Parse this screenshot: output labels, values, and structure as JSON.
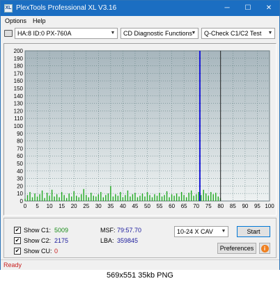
{
  "window": {
    "title": "PlexTools Professional XL V3.16",
    "icon_text": "XL",
    "minimize": "─",
    "maximize": "☐",
    "close": "✕"
  },
  "menu": [
    "Options",
    "Help"
  ],
  "toolbar": {
    "drive": "HA:8 ID:0  PX-760A",
    "function": "CD Diagnostic Functions",
    "test": "Q-Check C1/C2 Test"
  },
  "chart_data": {
    "type": "area",
    "title": "",
    "xlabel": "",
    "ylabel": "",
    "xlim": [
      0,
      100
    ],
    "ylim": [
      0,
      200
    ],
    "x_ticks": [
      0,
      5,
      10,
      15,
      20,
      25,
      30,
      35,
      40,
      45,
      50,
      55,
      60,
      65,
      70,
      75,
      80,
      85,
      90,
      95,
      100
    ],
    "y_ticks": [
      0,
      10,
      20,
      30,
      40,
      50,
      60,
      70,
      80,
      90,
      100,
      110,
      120,
      130,
      140,
      150,
      160,
      170,
      180,
      190,
      200
    ],
    "grid": true,
    "series": [
      {
        "color": "#1fa81f",
        "x": [
          0,
          1,
          2,
          3,
          4,
          5,
          6,
          7,
          8,
          9,
          10,
          11,
          12,
          13,
          14,
          15,
          16,
          17,
          18,
          19,
          20,
          21,
          22,
          23,
          24,
          25,
          26,
          27,
          28,
          29,
          30,
          31,
          32,
          33,
          34,
          35,
          36,
          37,
          38,
          39,
          40,
          41,
          42,
          43,
          44,
          45,
          46,
          47,
          48,
          49,
          50,
          51,
          52,
          53,
          54,
          55,
          56,
          57,
          58,
          59,
          60,
          61,
          62,
          63,
          64,
          65,
          66,
          67,
          68,
          69,
          70,
          71,
          72,
          73,
          74,
          75,
          76,
          77,
          78,
          79,
          79.9
        ],
        "y": [
          3,
          8,
          12,
          5,
          10,
          6,
          9,
          14,
          4,
          11,
          7,
          15,
          6,
          9,
          5,
          12,
          8,
          4,
          10,
          6,
          13,
          7,
          5,
          9,
          16,
          8,
          5,
          11,
          7,
          6,
          9,
          12,
          5,
          8,
          10,
          20,
          6,
          9,
          7,
          12,
          5,
          8,
          14,
          6,
          9,
          11,
          5,
          7,
          10,
          6,
          12,
          8,
          5,
          9,
          7,
          11,
          6,
          8,
          13,
          5,
          9,
          7,
          10,
          6,
          12,
          8,
          5,
          11,
          14,
          7,
          9,
          12,
          8,
          15,
          10,
          7,
          12,
          9,
          11,
          6,
          4
        ]
      }
    ],
    "markers": [
      {
        "x": 71.5,
        "color": "#1a1ad8"
      },
      {
        "x": 79.96,
        "color": "#222222"
      }
    ],
    "plot_background": [
      "#a7b6bd",
      "#eef2f2"
    ]
  },
  "stats": {
    "c1": {
      "label": "Show C1:",
      "value": "5009"
    },
    "c2": {
      "label": "Show C2:",
      "value": "2175"
    },
    "cu": {
      "label": "Show CU:",
      "value": "0"
    },
    "msf": {
      "label": "MSF:",
      "value": "79:57.70"
    },
    "lba": {
      "label": "LBA:",
      "value": "359845"
    }
  },
  "speed": "10-24 X CAV",
  "buttons": {
    "start": "Start",
    "preferences": "Preferences",
    "info": "i"
  },
  "status": "Ready",
  "caption": "569x551  35kb  PNG",
  "checkmark": "✔",
  "arrow": "▼"
}
